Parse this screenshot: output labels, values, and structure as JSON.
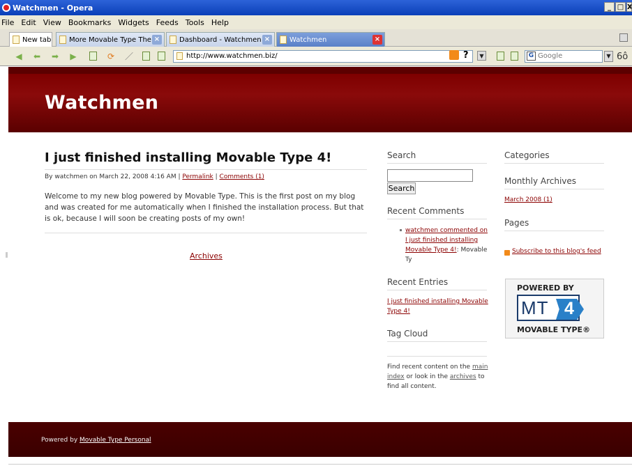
{
  "window": {
    "title": "Watchmen - Opera",
    "min": "_",
    "max": "□",
    "close": "X"
  },
  "menu": [
    "File",
    "Edit",
    "View",
    "Bookmarks",
    "Widgets",
    "Feeds",
    "Tools",
    "Help"
  ],
  "tabs": [
    {
      "label": "New tab"
    },
    {
      "label": "More Movable Type The..."
    },
    {
      "label": "Dashboard - Watchmen |..."
    },
    {
      "label": "Watchmen"
    }
  ],
  "address": {
    "url": "http://www.watchmen.biz/"
  },
  "search_engine": {
    "placeholder": "Google",
    "icon_letter": "G"
  },
  "toolbar_help": "?",
  "site": {
    "title": "Watchmen"
  },
  "post": {
    "title": "I just finished installing Movable Type 4!",
    "byline_prefix": "By watchmen on March 22, 2008 4:16 AM |",
    "permalink": "Permalink",
    "sep": "|",
    "comments": "Comments (1)",
    "body": "Welcome to my new blog powered by Movable Type. This is the first post on my blog and was created for me automatically when I finished the installation process. But that is ok, because I will soon be creating posts of my own!",
    "archives": "Archives"
  },
  "sidebar": {
    "search_heading": "Search",
    "search_button": "Search",
    "recent_comments_heading": "Recent Comments",
    "recent_comment_link": "watchmen commented on I just finished installing Movable Type 4!",
    "recent_comment_tail": ": Movable Ty",
    "recent_entries_heading": "Recent Entries",
    "recent_entry_link": "I just finished installing Movable Type 4!",
    "tag_cloud_heading": "Tag Cloud",
    "find_text_1": "Find recent content on the",
    "main_index": "main index",
    "find_text_2": "or look in the",
    "archives": "archives",
    "find_text_3": "to find all content."
  },
  "right_sidebar": {
    "categories_heading": "Categories",
    "monthly_heading": "Monthly Archives",
    "monthly_link": "March 2008 (1)",
    "pages_heading": "Pages",
    "subscribe_link": "Subscribe to this blog's feed"
  },
  "badge": {
    "powered": "POWERED BY",
    "letters": "MT",
    "number": "4",
    "name": "MOVABLE TYPE®"
  },
  "footer": {
    "prefix": "Powered by",
    "link": "Movable Type Personal"
  },
  "colors": {
    "header": "#7e0000",
    "link": "#8b0000",
    "footer": "#3a0000"
  }
}
